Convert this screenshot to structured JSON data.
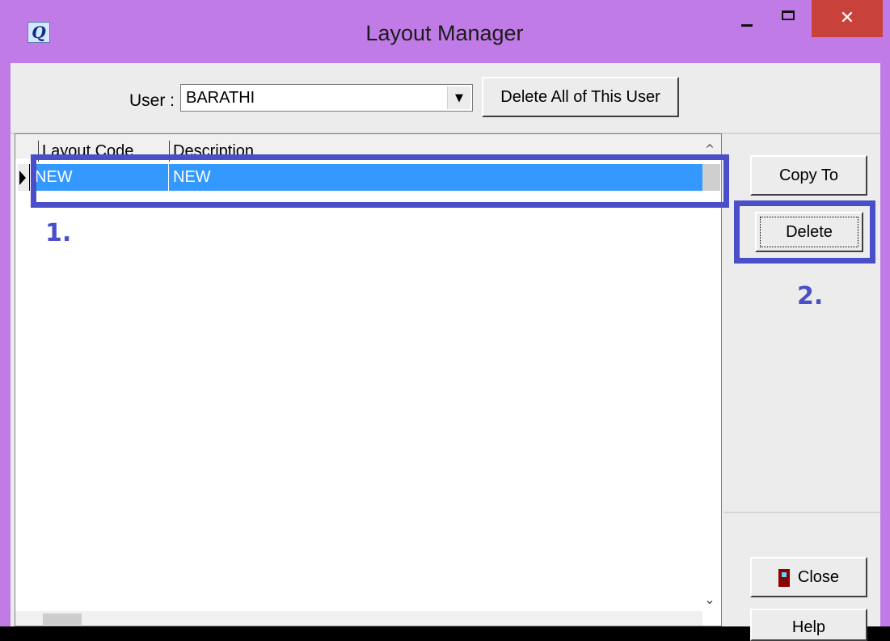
{
  "window": {
    "title": "Layout Manager",
    "app_icon_letter": "Q",
    "close_glyph": "✕",
    "titlebar_color": "#c07be6"
  },
  "toolbar": {
    "user_label": "User :",
    "user_value": "BARATHI",
    "delete_all_label": "Delete All of This User"
  },
  "grid": {
    "columns": [
      "Layout Code",
      "Description"
    ],
    "rows": [
      {
        "layout_code": "NEW",
        "description": "NEW"
      }
    ],
    "selection_color": "#3399ff"
  },
  "actions": {
    "copy_to": "Copy To",
    "delete": "Delete",
    "close": "Close",
    "help": "Help"
  },
  "annotations": {
    "step1": "1.",
    "step2": "2.",
    "color": "#4a4fc9"
  }
}
